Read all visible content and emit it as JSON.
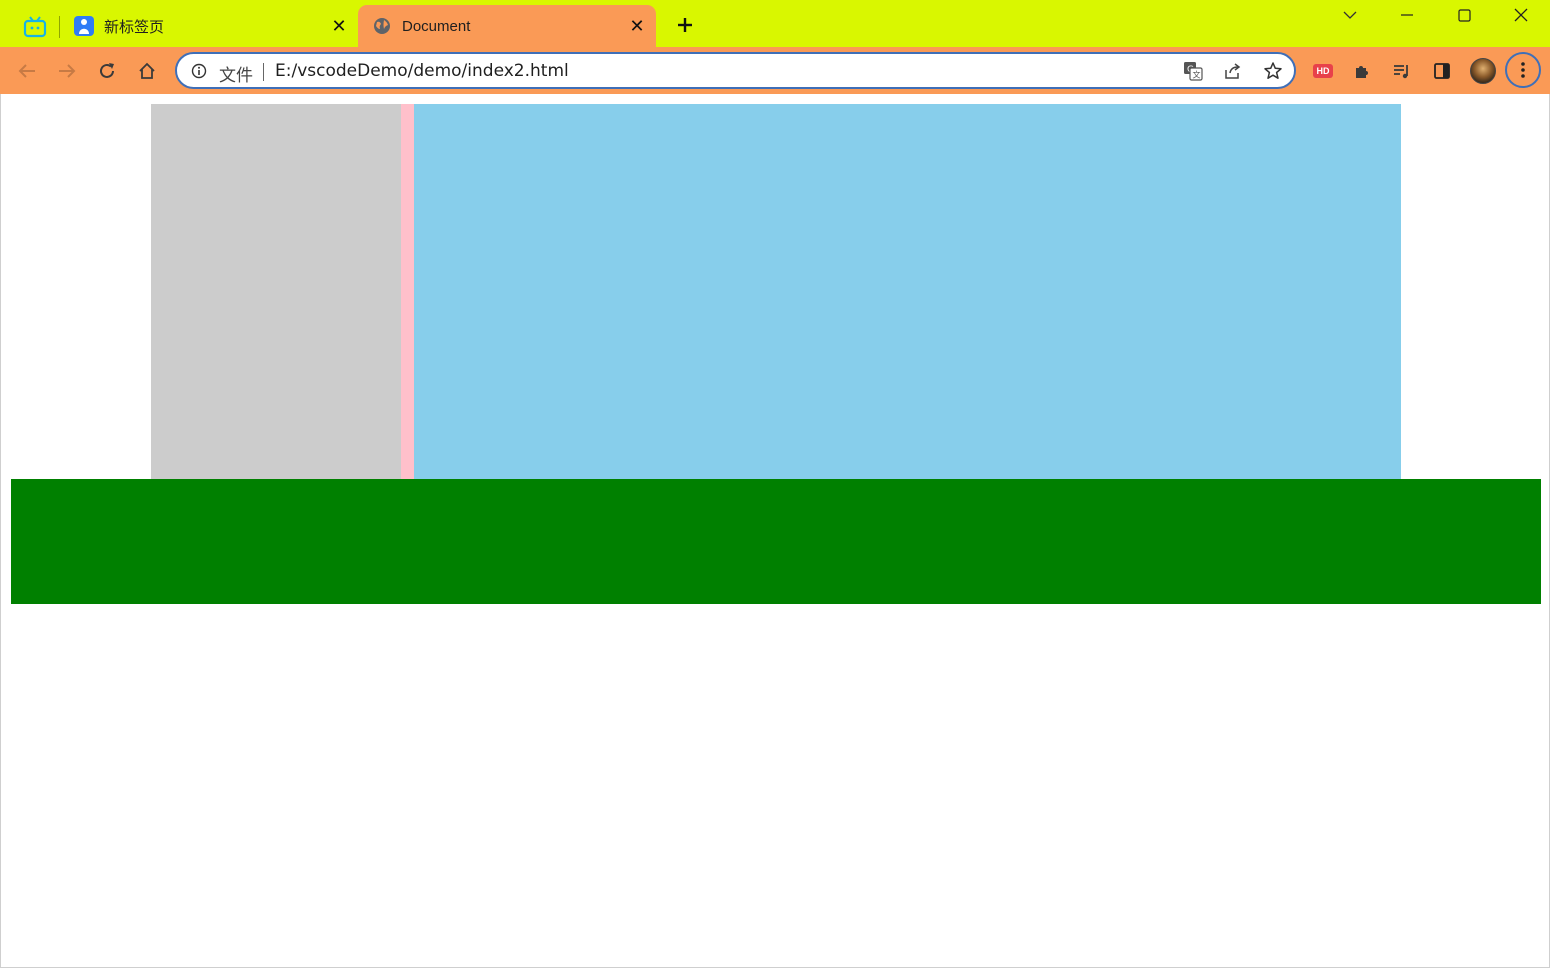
{
  "browser": {
    "tabs": [
      {
        "title": "新标签页",
        "favicon": "person-favicon-icon",
        "active": false
      },
      {
        "title": "Document",
        "favicon": "globe-icon",
        "active": true
      }
    ],
    "new_tab_symbol": "+",
    "close_symbol": "✕"
  },
  "toolbar": {
    "address": {
      "scheme_label": "文件",
      "url": "E:/vscodeDemo/demo/index2.html"
    },
    "extension_badge": "HD"
  },
  "colors": {
    "tabstrip": "#d9f700",
    "toolbar": "#fa9a56",
    "grey_box": "#cccccc",
    "pink_box": "#ffc0cb",
    "blue_box": "#87ceeb",
    "green_box": "#008000"
  }
}
